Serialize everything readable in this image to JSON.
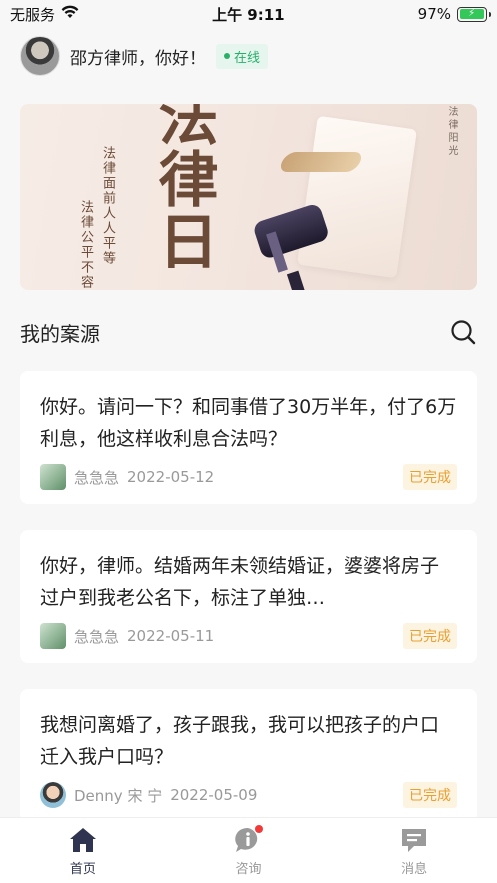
{
  "status_bar": {
    "carrier": "无服务",
    "time": "上午 9:11",
    "battery": "97%",
    "battery_level": 0.97
  },
  "header": {
    "greeting": "邵方律师，你好！",
    "online_label": "在线"
  },
  "banner": {
    "big_text": "法律日",
    "line1": "法律面前人人平等",
    "line2": "法律公平不容",
    "side_text": "法律阳光"
  },
  "section": {
    "title": "我的案源"
  },
  "cases": [
    {
      "text": "你好。请问一下？和同事借了30万半年，付了6万利息，他这样收利息合法吗？",
      "user": "急急急",
      "date": "2022-05-12",
      "status": "已完成"
    },
    {
      "text": "你好，律师。结婚两年未领结婚证，婆婆将房子过户到我老公名下，标注了单独…",
      "user": "急急急",
      "date": "2022-05-11",
      "status": "已完成"
    },
    {
      "text": "我想问离婚了，孩子跟我，我可以把孩子的户口迁入我户口吗？",
      "user": "Denny 宋 宁",
      "date": "2022-05-09",
      "status": "已完成"
    }
  ],
  "tabbar": {
    "home": "首页",
    "consult": "咨询",
    "messages": "消息"
  },
  "colors": {
    "accent": "#2f3550",
    "online": "#28b06a",
    "status_tag": "#e8a033",
    "badge_red": "#f23a3a"
  },
  "icons": {
    "search": "search-icon",
    "home": "home-icon",
    "consult": "info-icon",
    "messages": "message-icon",
    "wifi": "wifi-icon"
  }
}
